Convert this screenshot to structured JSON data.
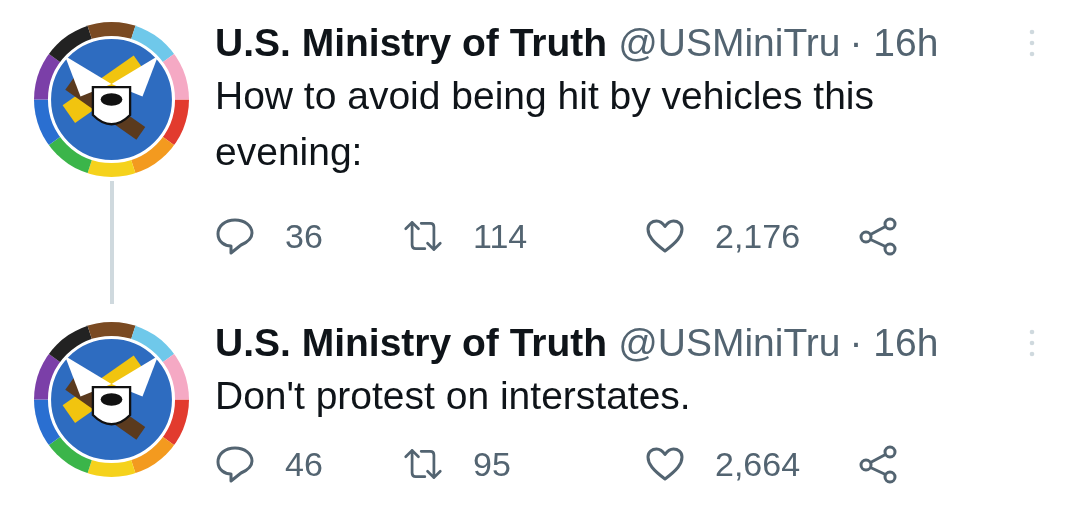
{
  "tweets": [
    {
      "name": "U.S. Ministry of Truth",
      "handle": "@USMiniTru",
      "time": "· 16h",
      "text": "How to avoid being hit by vehicles this evening:",
      "replies": "36",
      "retweets": "114",
      "likes": "2,176",
      "thread_line": true
    },
    {
      "name": "U.S. Ministry of Truth",
      "handle": "@USMiniTru",
      "time": "· 16h",
      "text": "Don't protest on interstates.",
      "replies": "46",
      "retweets": "95",
      "likes": "2,664",
      "thread_line": false
    }
  ]
}
